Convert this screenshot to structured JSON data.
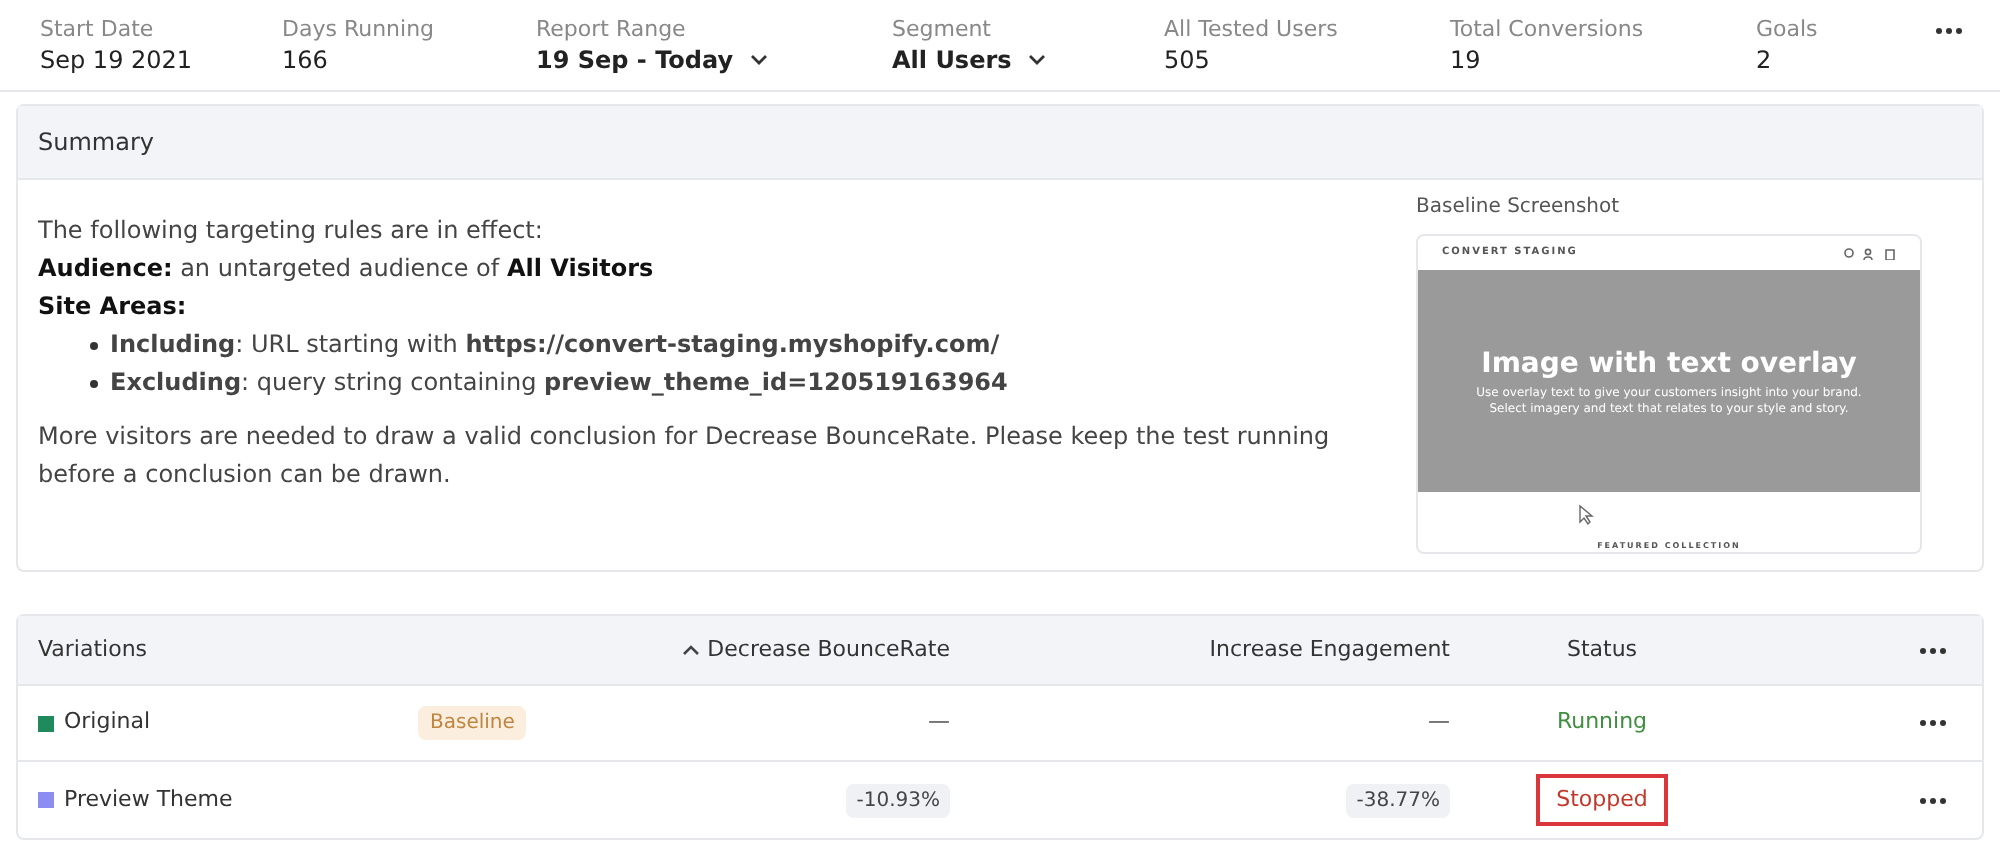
{
  "stats": [
    {
      "label": "Start Date",
      "value": "Sep 19 2021",
      "dropdown": false
    },
    {
      "label": "Days Running",
      "value": "166",
      "dropdown": false
    },
    {
      "label": "Report Range",
      "value": "19 Sep - Today",
      "dropdown": true
    },
    {
      "label": "Segment",
      "value": "All Users",
      "dropdown": true
    },
    {
      "label": "All Tested Users",
      "value": "505",
      "dropdown": false
    },
    {
      "label": "Total Conversions",
      "value": "19",
      "dropdown": false
    },
    {
      "label": "Goals",
      "value": "2",
      "dropdown": false
    }
  ],
  "summary": {
    "title": "Summary",
    "intro": "The following targeting rules are in effect:",
    "audience": "**Audience:** an untargeted audience of **All Visitors**",
    "site_areas": "Site Areas:",
    "rules": [
      "**Including**: URL starting with **https://convert-staging.myshopify.com/**",
      "**Excluding**: query string containing **preview_theme_id=120519163964**"
    ],
    "note": "More visitors are needed to draw a valid conclusion for Decrease BounceRate. Please keep the test running before a conclusion can be drawn.",
    "screenshot": {
      "label": "Baseline Screenshot",
      "brand": "CONVERT STAGING",
      "headline": "Image with text overlay",
      "subline": "Use overlay text to give your customers insight into your brand. Select imagery and text that relates to your style and story.",
      "footer": "FEATURED COLLECTION"
    }
  },
  "table": {
    "columns": [
      "Variations",
      "Decrease BounceRate",
      "Increase Engagement",
      "Status"
    ],
    "rows": [
      {
        "name": "Original",
        "color": "#1f8a5b",
        "badge": "Baseline",
        "bounce": "—",
        "engagement": "—",
        "status": "Running",
        "kind": "running",
        "highlighted": false
      },
      {
        "name": "Preview Theme",
        "color": "#8b8ef0",
        "bounce": "-10.93%",
        "engagement": "-38.77%",
        "status": "Stopped",
        "kind": "stopped",
        "highlighted": true
      }
    ]
  }
}
